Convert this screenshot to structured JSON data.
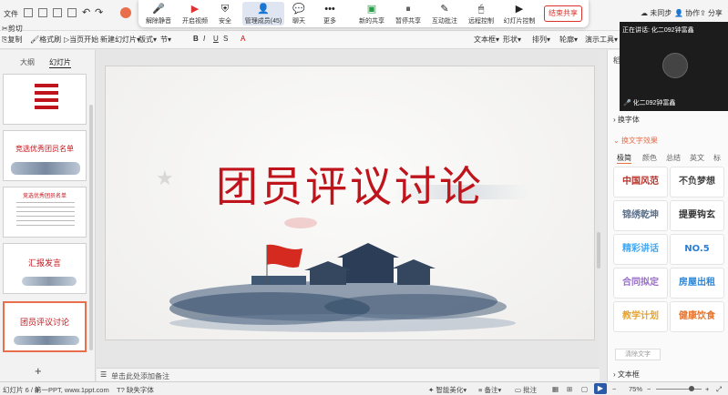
{
  "titlebar": {
    "file_menu": "文件",
    "right_tools": [
      "未同步",
      "协作",
      "分享"
    ]
  },
  "meeting_bar": {
    "buttons": [
      {
        "label": "解除静音",
        "icon": "mic-muted-icon"
      },
      {
        "label": "开启视频",
        "icon": "camera-off-icon"
      },
      {
        "label": "安全",
        "icon": "shield-icon"
      },
      {
        "label": "管理成员(45)",
        "icon": "members-icon"
      },
      {
        "label": "聊天",
        "icon": "chat-icon"
      },
      {
        "label": "更多",
        "icon": "more-icon"
      },
      {
        "label": "新的共享",
        "icon": "share-screen-icon"
      },
      {
        "label": "暂停共享",
        "icon": "pause-icon"
      },
      {
        "label": "互动批注",
        "icon": "annotate-icon"
      },
      {
        "label": "远程控制",
        "icon": "remote-control-icon"
      },
      {
        "label": "幻灯片控制",
        "icon": "slide-control-icon"
      }
    ],
    "end_share": "结束共享"
  },
  "ribbon": {
    "items": [
      "剪切",
      "复制",
      "格式刷",
      "当页开始",
      "新建幻灯片",
      "版式",
      "节",
      "文本框",
      "形状",
      "排列",
      "轮廓",
      "演示工具"
    ]
  },
  "left_panel": {
    "tabs": [
      "大纲",
      "幻灯片"
    ],
    "slides": [
      {
        "num": "",
        "title": ""
      },
      {
        "num": "",
        "title": "竞选优秀团员名单"
      },
      {
        "num": "",
        "title": "竞选优秀团员名单"
      },
      {
        "num": "",
        "title": "汇报发言"
      },
      {
        "num": "",
        "title": "团员评议讨论"
      }
    ],
    "add_slide": "+"
  },
  "slide": {
    "title": "团员评议讨论"
  },
  "notes": {
    "placeholder": "单击此处添加备注"
  },
  "video": {
    "speaking": "正在讲话: 化二092钟富鑫",
    "name": "化二092钟富鑫"
  },
  "right_panel": {
    "header": "稻壳",
    "sections": [
      "换字体",
      "换文字效果"
    ],
    "tabs": [
      "极简",
      "颜色",
      "总结",
      "英文",
      "标"
    ],
    "samples": [
      {
        "text": "中国风范",
        "color": "#b8322a"
      },
      {
        "text": "不负梦想",
        "color": "#444444"
      },
      {
        "text": "锦绣乾坤",
        "color": "#5a6f8a"
      },
      {
        "text": "提要钩玄",
        "color": "#333333"
      },
      {
        "text": "精彩讲话",
        "color": "#3fa9f5"
      },
      {
        "text": "NO.5",
        "color": "#2a7fd4"
      },
      {
        "text": "合同拟定",
        "color": "#9a6fc9"
      },
      {
        "text": "房屋出租",
        "color": "#2d86d6"
      },
      {
        "text": "教学计划",
        "color": "#e8a32c"
      },
      {
        "text": "健康饮食",
        "color": "#e8742c"
      }
    ],
    "clear_effect": "清除文字",
    "textbox": "文本框"
  },
  "statusbar": {
    "slide_count": "幻灯片 6 / 8",
    "theme": "第一PPT, www.1ppt.com",
    "missing_font": "缺失字体",
    "smart_beautify": "智能美化",
    "notes": "备注",
    "comments": "批注",
    "zoom": "75%"
  },
  "colors": {
    "accent_red": "#c0141c",
    "selection_orange": "#e86e4c"
  }
}
